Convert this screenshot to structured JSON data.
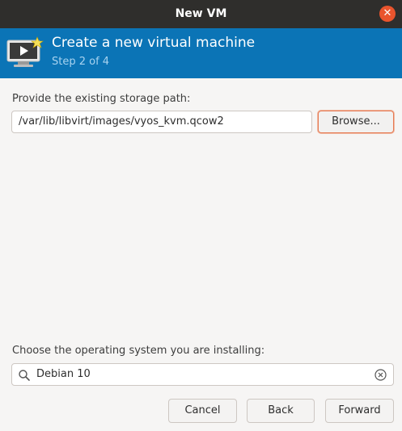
{
  "window": {
    "title": "New VM"
  },
  "header": {
    "title": "Create a new virtual machine",
    "step": "Step 2 of 4"
  },
  "storage": {
    "label": "Provide the existing storage path:",
    "path_value": "/var/lib/libvirt/images/vyos_kvm.qcow2",
    "browse_label": "Browse..."
  },
  "os": {
    "label": "Choose the operating system you are installing:",
    "search_value": "Debian 10"
  },
  "buttons": {
    "cancel": "Cancel",
    "back": "Back",
    "forward": "Forward"
  },
  "colors": {
    "titlebar": "#2f2e2c",
    "header": "#0b74b6",
    "close": "#e9542d",
    "focus": "#e67a52"
  },
  "icons": {
    "close": "close-icon",
    "header": "vm-monitor-icon",
    "search": "search-icon",
    "clear": "clear-icon"
  }
}
